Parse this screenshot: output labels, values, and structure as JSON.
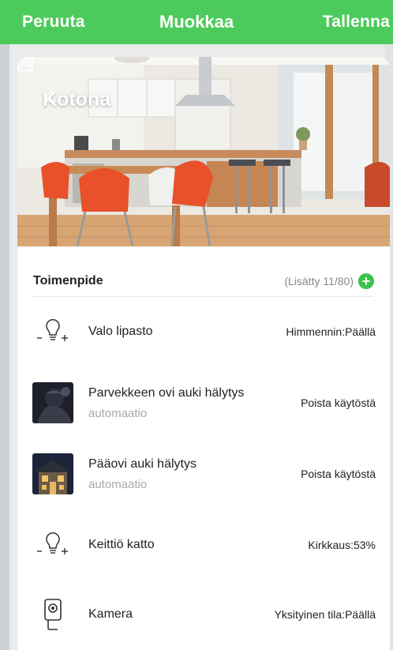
{
  "topbar": {
    "cancel_label": "Peruuta",
    "title": "Muokkaa",
    "save_label": "Tallenna"
  },
  "home": {
    "name": "Kotona"
  },
  "section": {
    "label": "Toimenpide",
    "added_count": "(Lisätty 11/80)"
  },
  "actions": [
    {
      "name": "Valo lipasto",
      "subtitle": "",
      "status": "Himmennin:Päällä",
      "icon": "bulb-dimmer-icon"
    },
    {
      "name": "Parvekkeen ovi auki hälytys",
      "subtitle": "automaatio",
      "status": "Poista käytöstä",
      "icon": "automation-thumbnail"
    },
    {
      "name": "Pääovi auki hälytys",
      "subtitle": "automaatio",
      "status": "Poista käytöstä",
      "icon": "automation-thumbnail"
    },
    {
      "name": "Keittiö katto",
      "subtitle": "",
      "status": "Kirkkaus:53%",
      "icon": "bulb-dimmer-icon"
    },
    {
      "name": "Kamera",
      "subtitle": "",
      "status": "Yksityinen tila:Päällä",
      "icon": "camera-icon"
    }
  ],
  "colors": {
    "accent": "#4ccb5c",
    "add_button": "#3bc24d"
  }
}
